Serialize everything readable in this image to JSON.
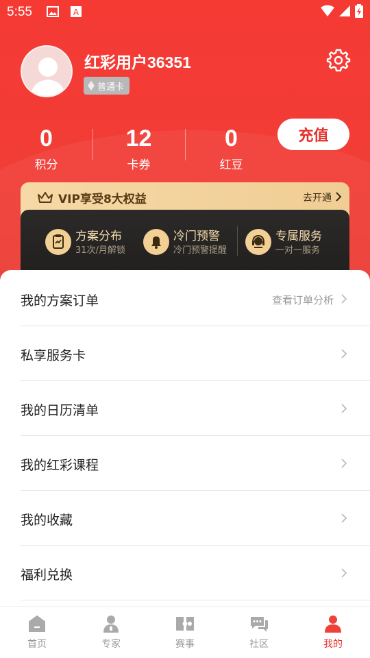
{
  "status_bar": {
    "time": "5:55"
  },
  "profile": {
    "username": "红彩用户36351",
    "membership_badge": "普通卡"
  },
  "stats": [
    {
      "value": "0",
      "label": "积分"
    },
    {
      "value": "12",
      "label": "卡券"
    },
    {
      "value": "0",
      "label": "红豆"
    }
  ],
  "recharge_label": "充值",
  "vip": {
    "title": "VIP享受8大权益",
    "open_label": "去开通",
    "perks": [
      {
        "icon": "clipboard-icon",
        "title": "方案分布",
        "subtitle": "31次/月解锁"
      },
      {
        "icon": "bell-icon",
        "title": "冷门预警",
        "subtitle": "冷门预警提醒"
      },
      {
        "icon": "headset-icon",
        "title": "专属服务",
        "subtitle": "一对一服务"
      }
    ]
  },
  "menu": [
    {
      "label": "我的方案订单",
      "hint": "查看订单分析"
    },
    {
      "label": "私享服务卡",
      "hint": ""
    },
    {
      "label": "我的日历清单",
      "hint": ""
    },
    {
      "label": "我的红彩课程",
      "hint": ""
    },
    {
      "label": "我的收藏",
      "hint": ""
    },
    {
      "label": "福利兑换",
      "hint": ""
    }
  ],
  "tabs": [
    {
      "label": "首页",
      "icon": "home-icon"
    },
    {
      "label": "专家",
      "icon": "expert-icon"
    },
    {
      "label": "赛事",
      "icon": "match-icon"
    },
    {
      "label": "社区",
      "icon": "community-icon"
    },
    {
      "label": "我的",
      "icon": "profile-icon"
    }
  ],
  "active_tab": "我的",
  "colors": {
    "accent": "#e4312b",
    "vip_gold": "#f2cf94"
  }
}
